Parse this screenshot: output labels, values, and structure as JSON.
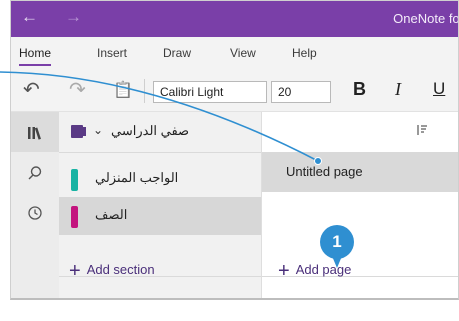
{
  "window": {
    "title": "OneNote for",
    "back_icon": "←",
    "forward_icon": "→"
  },
  "tabs": [
    "Home",
    "Insert",
    "Draw",
    "View",
    "Help"
  ],
  "toolbar": {
    "undo_icon": "↶",
    "redo_icon": "↷",
    "paste_icon": "📋",
    "font_name": "Calibri Light",
    "font_size": "20",
    "bold": "B",
    "italic": "I",
    "underline": "U"
  },
  "rail": {
    "notebooks_icon": "▮▮\\",
    "search_icon": "⚲",
    "recent_icon": "◷"
  },
  "notebook": {
    "name": "صفي الدراسي",
    "chevron": "⌄"
  },
  "sections": [
    {
      "label": "الواجب المنزلي",
      "color": "#17b3a3"
    },
    {
      "label": "الصف",
      "color": "#c3147e"
    }
  ],
  "add_section": {
    "plus": "+",
    "label": "Add section"
  },
  "pages": [
    {
      "title": "Untitled page"
    }
  ],
  "add_page": {
    "plus": "+",
    "label": "Add page"
  },
  "callout": {
    "number": "1",
    "color": "#2f8fd1"
  }
}
